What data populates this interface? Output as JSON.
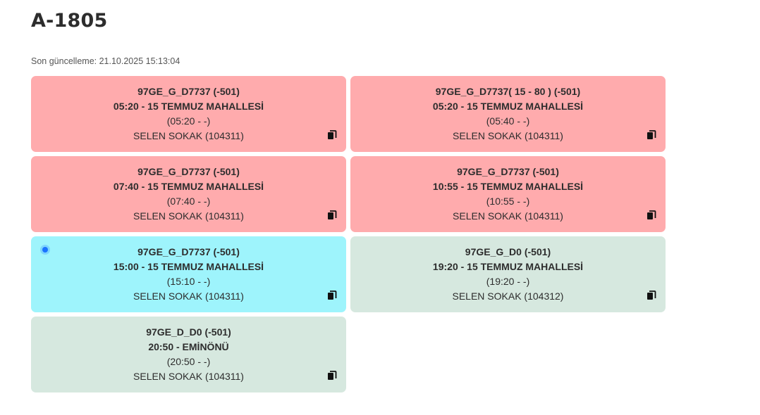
{
  "page": {
    "title": "A-1805",
    "last_update": "Son güncelleme: 21.10.2025 15:13:04"
  },
  "colors": {
    "late": "#ffabad",
    "current": "#9ef4fc",
    "upcoming": "#d6e8df"
  },
  "cards": [
    {
      "status": "late",
      "line1": "97GE_G_D7737 (-501)",
      "line2": "05:20 - 15 TEMMUZ MAHALLESİ",
      "line3": "(05:20 - -)",
      "line4": "SELEN SOKAK (104311)"
    },
    {
      "status": "late",
      "line1": "97GE_G_D7737( 15 - 80 ) (-501)",
      "line2": "05:20 - 15 TEMMUZ MAHALLESİ",
      "line3": "(05:40 - -)",
      "line4": "SELEN SOKAK (104311)"
    },
    {
      "status": "late",
      "line1": "97GE_G_D7737 (-501)",
      "line2": "07:40 - 15 TEMMUZ MAHALLESİ",
      "line3": "(07:40 - -)",
      "line4": "SELEN SOKAK (104311)"
    },
    {
      "status": "late",
      "line1": "97GE_G_D7737 (-501)",
      "line2": "10:55 - 15 TEMMUZ MAHALLESİ",
      "line3": "(10:55 - -)",
      "line4": "SELEN SOKAK (104311)"
    },
    {
      "status": "current",
      "line1": "97GE_G_D7737 (-501)",
      "line2": "15:00 - 15 TEMMUZ MAHALLESİ",
      "line3": "(15:10 - -)",
      "line4": "SELEN SOKAK (104311)"
    },
    {
      "status": "upcoming",
      "line1": "97GE_G_D0 (-501)",
      "line2": "19:20 - 15 TEMMUZ MAHALLESİ",
      "line3": "(19:20 - -)",
      "line4": "SELEN SOKAK (104312)"
    },
    {
      "status": "upcoming",
      "line1": "97GE_D_D0 (-501)",
      "line2": "20:50 - EMİNÖNÜ",
      "line3": "(20:50 - -)",
      "line4": "SELEN SOKAK (104311)"
    }
  ]
}
